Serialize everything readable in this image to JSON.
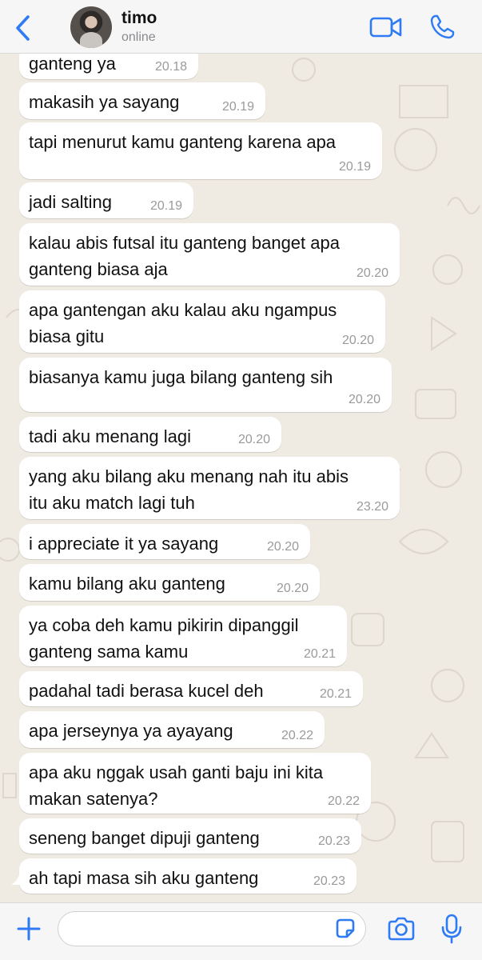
{
  "header": {
    "contact_name": "timo",
    "status": "online"
  },
  "colors": {
    "accent": "#2f7bf5",
    "wallpaper": "#efeae2",
    "bubble": "#ffffff",
    "time": "#9a9a9a"
  },
  "messages": [
    {
      "text": "ganteng ya",
      "time": "20.18"
    },
    {
      "text": "makasih ya sayang",
      "time": "20.19"
    },
    {
      "text": "tapi menurut kamu ganteng karena apa",
      "time": "20.19"
    },
    {
      "text": "jadi salting",
      "time": "20.19"
    },
    {
      "text": "kalau abis futsal itu ganteng banget apa\nganteng biasa aja",
      "time": "20.20"
    },
    {
      "text": "apa gantengan aku kalau aku ngampus\nbiasa gitu",
      "time": "20.20"
    },
    {
      "text": "biasanya kamu juga bilang ganteng sih",
      "time": "20.20"
    },
    {
      "text": "tadi aku menang lagi",
      "time": "20.20"
    },
    {
      "text": "yang aku bilang aku menang nah itu abis\nitu aku match lagi tuh",
      "time": "23.20"
    },
    {
      "text": "i appreciate it ya sayang",
      "time": "20.20"
    },
    {
      "text": "kamu bilang aku ganteng",
      "time": "20.20"
    },
    {
      "text": "ya coba deh kamu pikirin dipanggil\nganteng sama kamu",
      "time": "20.21"
    },
    {
      "text": "padahal tadi berasa kucel deh",
      "time": "20.21"
    },
    {
      "text": "apa jerseynya ya ayayang",
      "time": "20.22"
    },
    {
      "text": "apa aku nggak usah ganti baju ini kita\nmakan satenya?",
      "time": "20.22"
    },
    {
      "text": "seneng banget dipuji ganteng",
      "time": "20.23"
    },
    {
      "text": "ah tapi masa sih aku ganteng",
      "time": "20.23"
    }
  ],
  "input": {
    "value": "",
    "placeholder": ""
  },
  "icons": {
    "back": "chevron-left-icon",
    "video": "video-camera-icon",
    "call": "phone-icon",
    "plus": "plus-icon",
    "sticker": "sticker-icon",
    "camera": "camera-icon",
    "mic": "microphone-icon"
  }
}
